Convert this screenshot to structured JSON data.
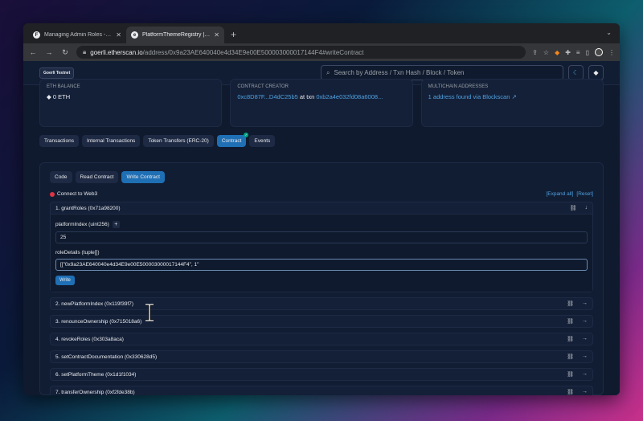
{
  "browser": {
    "tabs": [
      {
        "label": "Managing Admin Roles - Flexib",
        "favicon": "F",
        "active": false
      },
      {
        "label": "PlatformThemeRegistry | Addr",
        "favicon": "e",
        "active": true
      }
    ],
    "url_host": "goerli.etherscan.io",
    "url_path": "/address/0x9a23AE640040e4d34E9e00E500003000017144F4#writeContract"
  },
  "header": {
    "network_badge": "Goerli Testnet",
    "search_placeholder": "Search by Address / Txn Hash / Block / Token"
  },
  "overview": {
    "eth_balance_label": "ETH BALANCE",
    "eth_balance_value": "0 ETH",
    "creator_label": "CONTRACT CREATOR",
    "creator_address": "0xc8D87F...D4dC25b5",
    "creator_at_txn": "at txn",
    "creator_txn": "0xb2a4e032fd08a6008...",
    "multichain_label": "MULTICHAIN ADDRESSES",
    "multichain_value": "1 address found via Blockscan"
  },
  "tabs": [
    "Transactions",
    "Internal Transactions",
    "Token Transfers (ERC-20)",
    "Contract",
    "Events"
  ],
  "contract": {
    "subtabs": [
      "Code",
      "Read Contract",
      "Write Contract"
    ],
    "connect_label": "Connect to Web3",
    "expand_all": "[Expand all]",
    "reset": "[Reset]",
    "functions": [
      {
        "label": "1. grantRoles (0x71a98200)"
      },
      {
        "label": "2. newPlatformIndex (0x119f39f7)"
      },
      {
        "label": "3. renounceOwnership (0x715018a6)"
      },
      {
        "label": "4. revokeRoles (0x303a8aca)"
      },
      {
        "label": "5. setContractDocumentation (0x330628d5)"
      },
      {
        "label": "6. setPlatformTheme (0x1d1f1034)"
      },
      {
        "label": "7. transferOwnership (0xf2fde38b)"
      }
    ],
    "grant_roles": {
      "param1_label": "platformIndex (uint256)",
      "param1_value": "25",
      "param2_label": "roleDetails (tuple[])",
      "param2_value": "[[\"0x9a23AE640040e4d34E9e00E500003000017144F4\", 1\"",
      "write_label": "Write"
    }
  },
  "colors": {
    "accent": "#1f6fb5",
    "link": "#4ea1e0",
    "bg": "#0f1a2e"
  }
}
